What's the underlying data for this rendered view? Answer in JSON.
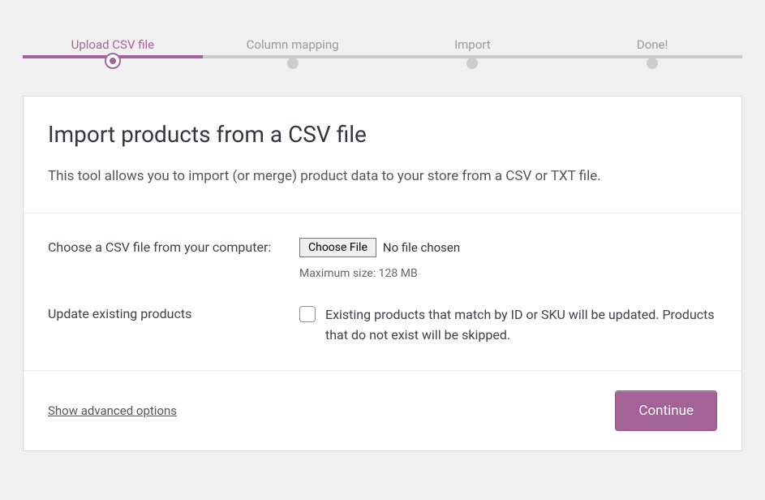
{
  "stepper": {
    "steps": [
      {
        "label": "Upload CSV file",
        "active": true
      },
      {
        "label": "Column mapping",
        "active": false
      },
      {
        "label": "Import",
        "active": false
      },
      {
        "label": "Done!",
        "active": false
      }
    ]
  },
  "header": {
    "title": "Import products from a CSV file",
    "description": "This tool allows you to import (or merge) product data to your store from a CSV or TXT file."
  },
  "form": {
    "file_field": {
      "label": "Choose a CSV file from your computer:",
      "button": "Choose File",
      "status": "No file chosen",
      "hint": "Maximum size: 128 MB"
    },
    "update_field": {
      "label": "Update existing products",
      "description": "Existing products that match by ID or SKU will be updated. Products that do not exist will be skipped."
    }
  },
  "footer": {
    "advanced_link": "Show advanced options",
    "continue_button": "Continue"
  }
}
